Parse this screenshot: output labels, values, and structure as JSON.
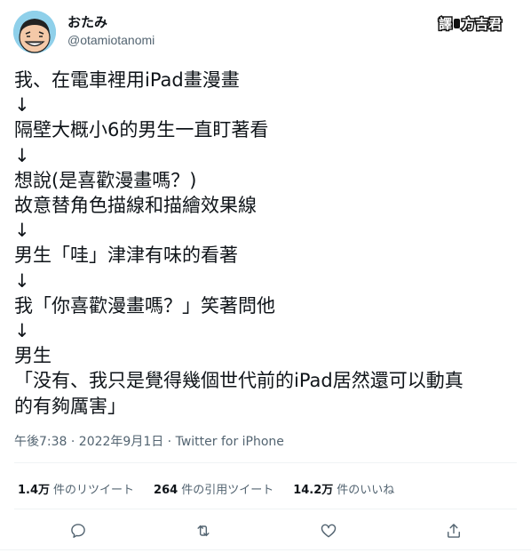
{
  "author": {
    "display_name": "おたみ",
    "handle": "@otamiotanomi"
  },
  "watermark": {
    "left": "譯",
    "right": "方吉君"
  },
  "tweet": {
    "lines": [
      "我、在電車裡用iPad畫漫畫",
      "↓",
      "隔壁大概小6的男生一直盯著看",
      "↓",
      "想說(是喜歡漫畫嗎？)",
      "故意替角色描線和描繪效果線",
      "↓",
      "男生「哇」津津有味的看著",
      "↓",
      "我「你喜歡漫畫嗎？」笑著問他",
      "↓",
      "男生",
      "「没有、我只是覺得幾個世代前的iPad居然還可以動真",
      "的有夠厲害」"
    ],
    "timestamp": "午後7:38 · 2022年9月1日 · Twitter for iPhone"
  },
  "stats": {
    "retweets_count": "1.4万",
    "retweets_label": "件のリツイート",
    "quotes_count": "264",
    "quotes_label": "件の引用ツイート",
    "likes_count": "14.2万",
    "likes_label": "件のいいね"
  },
  "icons": {
    "reply": "reply-icon",
    "retweet": "retweet-icon",
    "like": "heart-icon",
    "share": "share-icon"
  },
  "colors": {
    "text": "#0f1419",
    "secondary": "#536471",
    "divider": "#eff3f4",
    "avatar_bg": "#8fd0ea"
  }
}
